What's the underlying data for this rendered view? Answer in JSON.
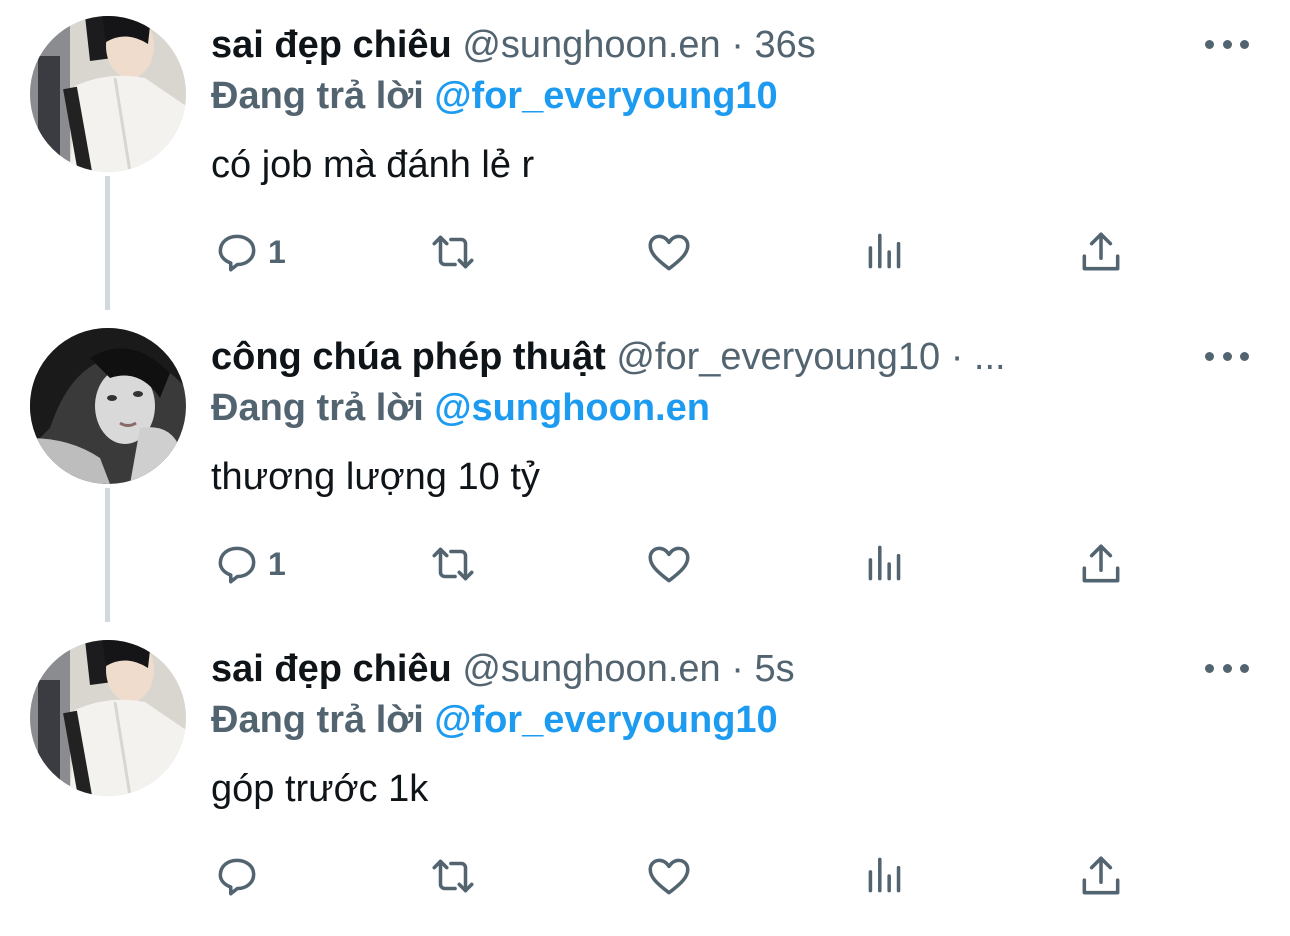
{
  "tweets": [
    {
      "display_name": "sai đẹp chiêu",
      "handle": "@sunghoon.en",
      "separator": "·",
      "time": "36s",
      "reply_prefix": "Đang trả lời",
      "reply_to": "@for_everyoung10",
      "text": "có job mà đánh lẻ r",
      "reply_count": "1",
      "avatar": "avatar-man-white-shirt"
    },
    {
      "display_name": "công chúa phép thuật",
      "handle": "@for_everyoung10",
      "separator": "·",
      "time": "...",
      "reply_prefix": "Đang trả lời",
      "reply_to": "@sunghoon.en",
      "text": "thương lượng 10 tỷ",
      "reply_count": "1",
      "avatar": "avatar-woman-bw"
    },
    {
      "display_name": "sai đẹp chiêu",
      "handle": "@sunghoon.en",
      "separator": "·",
      "time": "5s",
      "reply_prefix": "Đang trả lời",
      "reply_to": "@for_everyoung10",
      "text": "góp trước 1k",
      "reply_count": "",
      "avatar": "avatar-man-white-shirt"
    }
  ],
  "icons": {
    "reply": "speech-bubble-icon",
    "retweet": "retweet-icon",
    "like": "heart-icon",
    "views": "bar-chart-icon",
    "share": "share-icon",
    "more": "more-dots-icon"
  },
  "colors": {
    "text": "#0f1419",
    "secondary": "#536471",
    "accent": "#1d9bf0",
    "thread_line": "#cfd9de"
  }
}
